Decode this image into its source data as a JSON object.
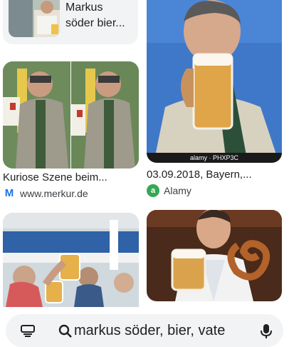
{
  "results": [
    {
      "title": "Markus\nsöder bier...",
      "source": ""
    },
    {
      "title": "Kuriose Szene beim...",
      "source": "www.merkur.de",
      "favicon": "merkur-icon"
    },
    {
      "title": "03.09.2018, Bayern,...",
      "source": "Alamy",
      "favicon": "alamy-icon",
      "watermark": "alamy · PHXP3C"
    },
    {
      "title": "",
      "source": ""
    },
    {
      "title": "",
      "source": ""
    }
  ],
  "search": {
    "query": "markus söder, bier, vate",
    "icons": [
      "lens-icon",
      "search-icon",
      "mic-icon"
    ]
  },
  "colors": {
    "accent": "#1a73e8",
    "alamy": "#34a853",
    "bar_bg": "#f1f3f4"
  }
}
